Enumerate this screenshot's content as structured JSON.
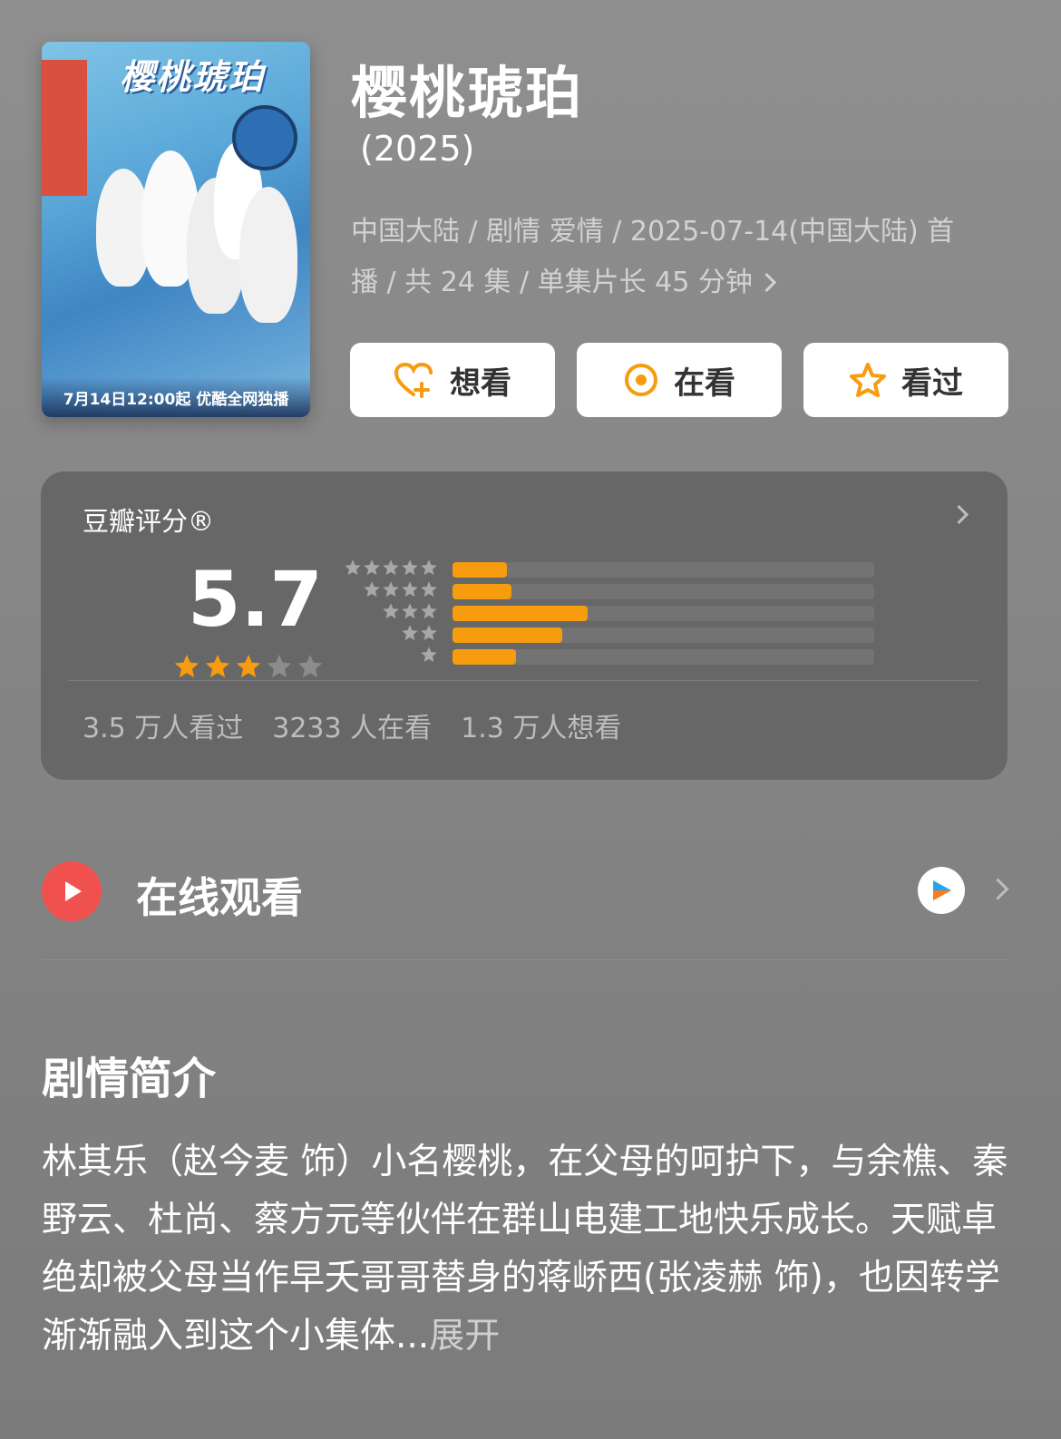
{
  "poster": {
    "title_art": "樱桃琥珀",
    "banner": "7月14日12:00起 优酷全网独播"
  },
  "show": {
    "title": "樱桃琥珀",
    "year": "(2025)",
    "meta_line1": "中国大陆 / 剧情 爱情 / 2025-07-14(中国大陆) 首",
    "meta_line2": "播 / 共 24 集 / 单集片长 45 分钟"
  },
  "actions": {
    "want": "想看",
    "watching": "在看",
    "watched": "看过"
  },
  "rating": {
    "label": "豆瓣评分®",
    "score": "5.7",
    "star_level": 3,
    "distribution": [
      {
        "stars": 5,
        "fraction": 0.13
      },
      {
        "stars": 4,
        "fraction": 0.14
      },
      {
        "stars": 3,
        "fraction": 0.32
      },
      {
        "stars": 2,
        "fraction": 0.26
      },
      {
        "stars": 1,
        "fraction": 0.15
      }
    ],
    "watched_count": "3.5 万人看过",
    "watching_count": "3233 人在看",
    "want_count": "1.3 万人想看"
  },
  "online": {
    "label": "在线观看",
    "platform_icon": "youku-icon"
  },
  "synopsis": {
    "title": "剧情简介",
    "text": "林其乐（赵今麦 饰）小名樱桃，在父母的呵护下，与余樵、秦野云、杜尚、蔡方元等伙伴在群山电建工地快乐成长。天赋卓绝却被父母当作早夭哥哥替身的蒋峤西(张凌赫 饰)，也因转学渐渐融入到这个小集体...",
    "more": "展开"
  },
  "colors": {
    "accent": "#f79b0f",
    "play": "#f0514f",
    "card": "#676767"
  }
}
